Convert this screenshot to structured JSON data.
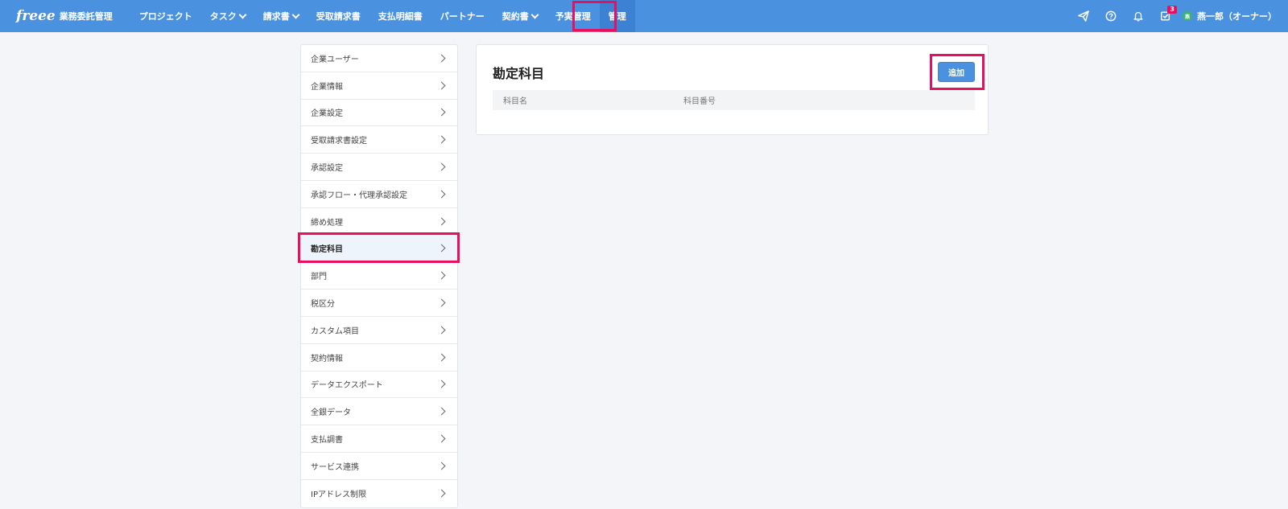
{
  "header": {
    "logo_mark": "freee",
    "logo_sub": "業務委託管理",
    "nav": [
      {
        "label": "プロジェクト",
        "dropdown": false
      },
      {
        "label": "タスク",
        "dropdown": true
      },
      {
        "label": "請求書",
        "dropdown": true
      },
      {
        "label": "受取請求書",
        "dropdown": false
      },
      {
        "label": "支払明細書",
        "dropdown": false
      },
      {
        "label": "パートナー",
        "dropdown": false
      },
      {
        "label": "契約書",
        "dropdown": true
      },
      {
        "label": "予実管理",
        "dropdown": false
      },
      {
        "label": "管理",
        "dropdown": false,
        "active": true
      }
    ],
    "icons": [
      "send-icon",
      "help-icon",
      "bell-icon",
      "task-check-icon"
    ],
    "task_badge": "3",
    "user": {
      "avatar_initial": "燕",
      "name": "燕一郎（オーナー）"
    }
  },
  "sidebar": {
    "items": [
      {
        "label": "企業ユーザー"
      },
      {
        "label": "企業情報"
      },
      {
        "label": "企業設定"
      },
      {
        "label": "受取請求書設定"
      },
      {
        "label": "承認設定"
      },
      {
        "label": "承認フロー・代理承認設定"
      },
      {
        "label": "締め処理"
      },
      {
        "label": "勘定科目",
        "active": true
      },
      {
        "label": "部門"
      },
      {
        "label": "税区分"
      },
      {
        "label": "カスタム項目"
      },
      {
        "label": "契約情報"
      },
      {
        "label": "データエクスポート"
      },
      {
        "label": "全銀データ"
      },
      {
        "label": "支払調書"
      },
      {
        "label": "サービス連携"
      },
      {
        "label": "IPアドレス制限"
      }
    ]
  },
  "main": {
    "title": "勘定科目",
    "add_label": "追加",
    "columns": [
      "科目名",
      "科目番号"
    ]
  },
  "colors": {
    "header_bg": "#4a92e0",
    "highlight": "#e8105e",
    "badge": "#e8105e",
    "page_bg": "#f4f5f9"
  }
}
